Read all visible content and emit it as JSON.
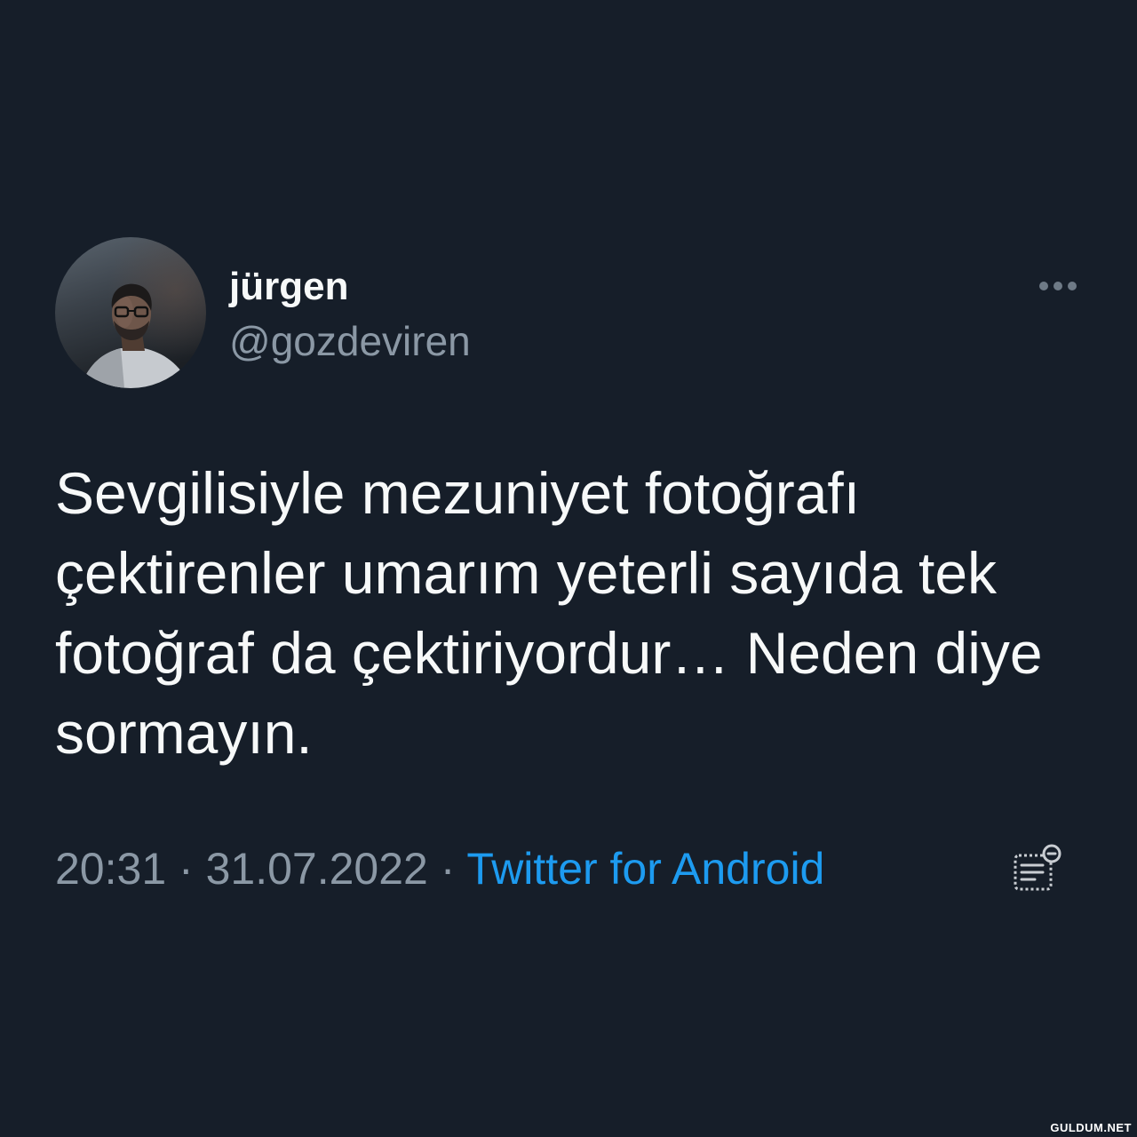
{
  "tweet": {
    "author": {
      "name": "jürgen",
      "handle": "@gozdeviren"
    },
    "text": "Sevgilisiyle mezuniyet fotoğrafı çektirenler umarım yeterli sayıda tek fotoğraf da çektiriyordur… Neden diye sormayın.",
    "meta": {
      "time": "20:31",
      "separator": "·",
      "date": "31.07.2022",
      "source": "Twitter for Android"
    }
  },
  "icons": {
    "more": "more-horizontal-icon",
    "analytics": "view-tweet-analytics-icon"
  },
  "watermark": "GULDUM.NET",
  "colors": {
    "background": "#161e29",
    "primary_text": "#f7f9f9",
    "secondary_text": "#8b98a5",
    "accent": "#1d9bf0"
  }
}
